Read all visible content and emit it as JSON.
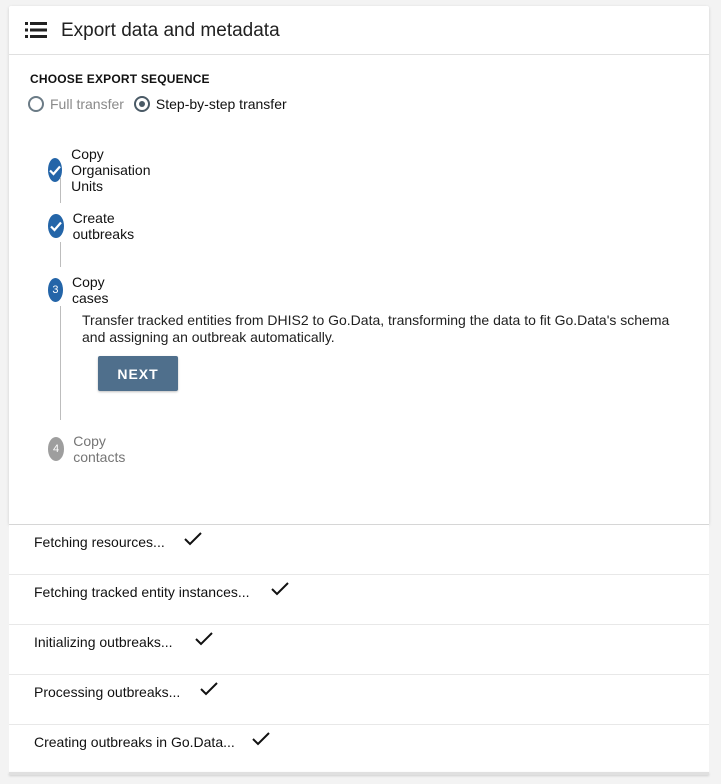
{
  "header": {
    "title": "Export data and metadata",
    "menu_icon": "list-icon"
  },
  "export_sequence": {
    "label": "CHOOSE EXPORT SEQUENCE",
    "options": [
      {
        "label": "Full transfer",
        "selected": false
      },
      {
        "label": "Step-by-step transfer",
        "selected": true
      }
    ]
  },
  "steps": [
    {
      "number": "1",
      "label": "Copy Organisation Units",
      "status": "done"
    },
    {
      "number": "2",
      "label": "Create outbreaks",
      "status": "done"
    },
    {
      "number": "3",
      "label": "Copy cases",
      "status": "active",
      "description": "Transfer tracked entities from DHIS2 to Go.Data, transforming the data to fit Go.Data's schema and assigning an outbreak automatically.",
      "button": "NEXT"
    },
    {
      "number": "4",
      "label": "Copy contacts",
      "status": "pending"
    }
  ],
  "log": [
    {
      "text": "Fetching resources...",
      "done": true
    },
    {
      "text": "Fetching tracked entity instances...",
      "done": true
    },
    {
      "text": "Initializing outbreaks...",
      "done": true
    },
    {
      "text": "Processing outbreaks...",
      "done": true
    },
    {
      "text": "Creating outbreaks in Go.Data...",
      "done": true
    }
  ],
  "colors": {
    "step_active": "#2465a8",
    "step_pending": "#9e9e9e",
    "button": "#4f6f8c"
  }
}
